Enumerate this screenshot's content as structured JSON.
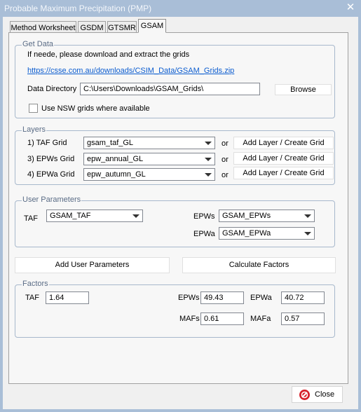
{
  "window": {
    "title": "Probable Maximum Precipitation (PMP)"
  },
  "tabs": [
    {
      "label": "Method Worksheet",
      "active": false
    },
    {
      "label": "GSDM",
      "active": false
    },
    {
      "label": "GTSMR",
      "active": false
    },
    {
      "label": "GSAM",
      "active": true
    }
  ],
  "get_data": {
    "heading": "Get Data",
    "instruction": "If neede, please download and extract the grids",
    "link": "https://csse.com.au/downloads/CSIM_Data/GSAM_Grids.zip",
    "dir_label": "Data Directory",
    "dir_value": "C:\\Users\\Downloads\\GSAM_Grids\\",
    "browse_label": "Browse",
    "nsw_label": "Use NSW grids where available",
    "nsw_checked": false
  },
  "layers": {
    "heading": "Layers",
    "or_label": "or",
    "rows": [
      {
        "label": "1) TAF Grid",
        "value": "gsam_taf_GL",
        "button": "Add Layer / Create Grid"
      },
      {
        "label": "3) EPWs Grid",
        "value": "epw_annual_GL",
        "button": "Add Layer / Create Grid"
      },
      {
        "label": "4) EPWa Grid",
        "value": "epw_autumn_GL",
        "button": "Add Layer / Create Grid"
      }
    ]
  },
  "user_params": {
    "heading": "User Parameters",
    "taf_label": "TAF",
    "taf_value": "GSAM_TAF",
    "epws_label": "EPWs",
    "epws_value": "GSAM_EPWs",
    "epwa_label": "EPWa",
    "epwa_value": "GSAM_EPWa"
  },
  "actions": {
    "add_user_params": "Add User Parameters",
    "calculate": "Calculate Factors"
  },
  "factors": {
    "heading": "Factors",
    "taf_label": "TAF",
    "taf_value": "1.64",
    "epws_label": "EPWs",
    "epws_value": "49.43",
    "epwa_label": "EPWa",
    "epwa_value": "40.72",
    "mafs_label": "MAFs",
    "mafs_value": "0.61",
    "mafa_label": "MAFa",
    "mafa_value": "0.57"
  },
  "footer": {
    "close_label": "Close"
  },
  "colors": {
    "titlebar": "#a9bed7",
    "group_label": "#5a6c86",
    "link": "#0b5ccf",
    "close_icon": "#d6202a"
  }
}
